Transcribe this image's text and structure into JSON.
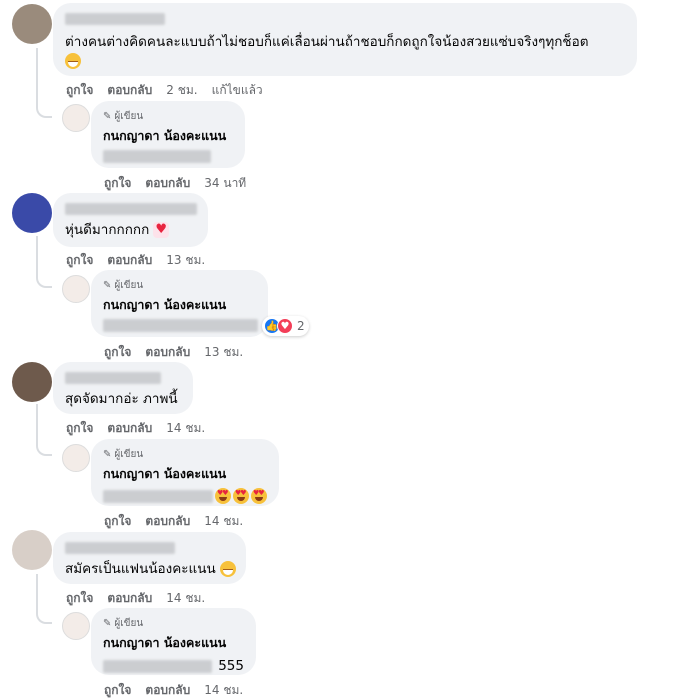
{
  "actions": {
    "like": "ถูกใจ",
    "reply": "ตอบกลับ"
  },
  "author_tag": "ผู้เขียน",
  "author_name": "กนกญาดา น้องคะแนน",
  "colors": {
    "bubble": "#f0f2f5",
    "meta": "#65676b",
    "like_blue": "#1877f2",
    "love_red": "#f33e58"
  },
  "comments": [
    {
      "text": "ต่างคนต่างคิดคนละแบบถ้าไม่ชอบก็แค่เลื่อนผ่านถ้าชอบก็กดถูกใจน้องสวยแซ่บจริงๆทุกช็อต",
      "emoji": "grinning-sweat-emoji",
      "time": "2 ชม.",
      "edited": "แก้ไขแล้ว",
      "reply": {
        "text": "",
        "time": "34 นาที"
      }
    },
    {
      "text": "หุ่นดีมากกกกก",
      "emoji": "beating-heart-emoji",
      "time": "13 ชม.",
      "reply": {
        "text": "",
        "time": "13 ชม.",
        "reaction_count": "2"
      }
    },
    {
      "text": "สุดจัดมากอ่ะ ภาพนี้",
      "time": "14 ชม.",
      "reply": {
        "text": "",
        "emoji": "heart-eyes-emoji x3",
        "time": "14 ชม."
      }
    },
    {
      "text": "สมัครเป็นแฟนน้องคะแนน",
      "emoji": "grinning-emoji",
      "time": "14 ชม.",
      "reply": {
        "text": "555",
        "time": "14 ชม."
      }
    }
  ]
}
